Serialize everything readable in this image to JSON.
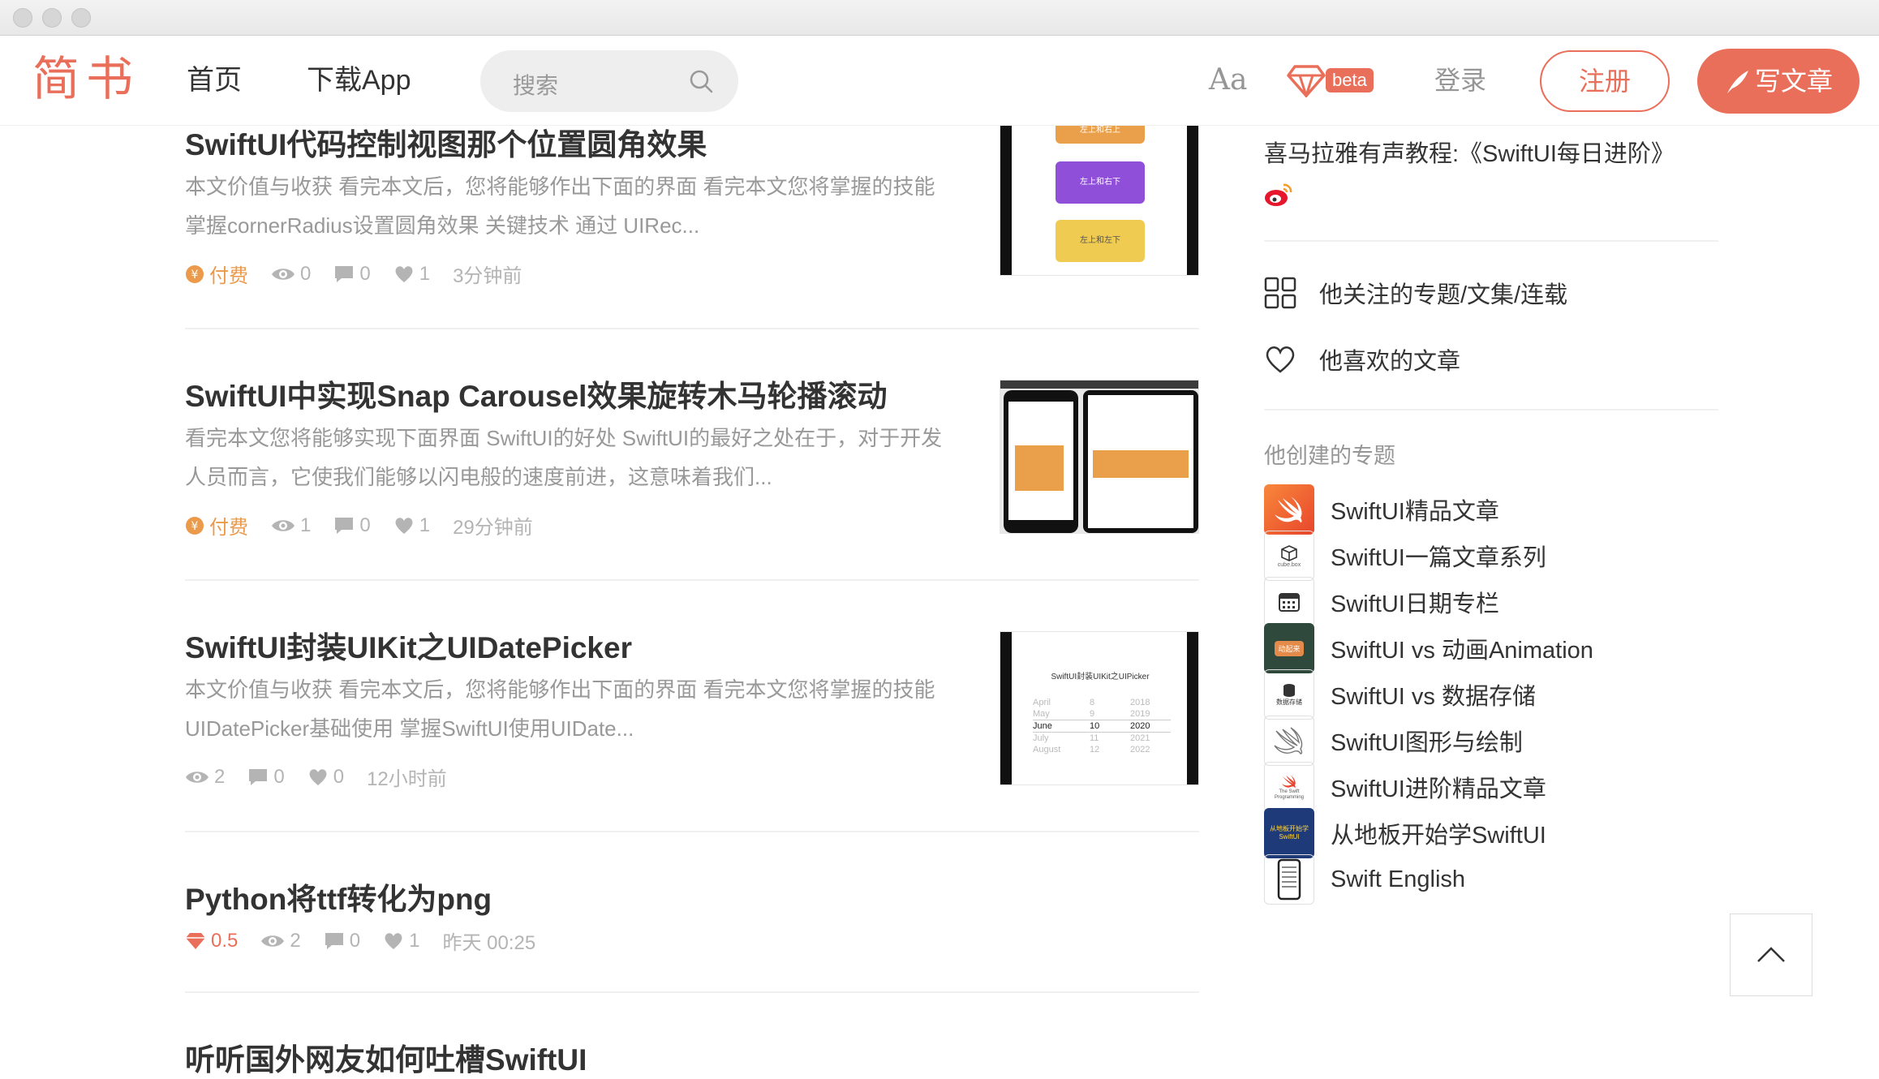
{
  "nav": {
    "logo": "简书",
    "home": "首页",
    "download": "下载App",
    "search_placeholder": "搜索",
    "font_toggle": "Aa",
    "beta": "beta",
    "login": "登录",
    "register": "注册",
    "write": "写文章"
  },
  "articles": [
    {
      "title": "SwiftUI代码控制视图那个位置圆角效果",
      "abstract_1": "本文价值与收获 看完本文后，您将能够作出下面的界面 看完本文您将掌握的技能",
      "abstract_2": "掌握cornerRadius设置圆角效果 关键技术 通过 UIRec...",
      "paid": "付费",
      "views": "0",
      "comments": "0",
      "likes": "1",
      "time": "3分钟前",
      "thumb_labels": [
        "左上和右上",
        "左上和右下",
        "左上和左下"
      ]
    },
    {
      "title": "SwiftUI中实现Snap Carousel效果旋转木马轮播滚动",
      "abstract_1": "看完本文您将能够实现下面界面 SwiftUI的好处 SwiftUI的最好之处在于，对于开发",
      "abstract_2": "人员而言，它使我们能够以闪电般的速度前进，这意味着我们...",
      "paid": "付费",
      "views": "1",
      "comments": "0",
      "likes": "1",
      "time": "29分钟前"
    },
    {
      "title": "SwiftUI封装UIKit之UIDatePicker",
      "abstract_1": "本文价值与收获 看完本文后，您将能够作出下面的界面 看完本文您将掌握的技能",
      "abstract_2": "UIDatePicker基础使用 掌握SwiftUI使用UIDate...",
      "views": "2",
      "comments": "0",
      "likes": "0",
      "time": "12小时前",
      "thumb_title": "SwiftUI封装UIKit之UIPicker",
      "picker_rows": [
        {
          "m": "April",
          "d": "8",
          "y": "2018"
        },
        {
          "m": "May",
          "d": "9",
          "y": "2019"
        },
        {
          "m": "June",
          "d": "10",
          "y": "2020"
        },
        {
          "m": "July",
          "d": "11",
          "y": "2021"
        },
        {
          "m": "August",
          "d": "12",
          "y": "2022"
        }
      ]
    },
    {
      "title": "Python将ttf转化为png",
      "price": "0.5",
      "views": "2",
      "comments": "0",
      "likes": "1",
      "time": "昨天 00:25"
    },
    {
      "title": "听听国外网友如何吐槽SwiftUI"
    }
  ],
  "sidebar": {
    "intro": "喜马拉雅有声教程:《SwiftUI每日进阶》",
    "link_following": "他关注的专题/文集/连载",
    "link_liked": "他喜欢的文章",
    "collections_heading": "他创建的专题",
    "collections": [
      {
        "name": "SwiftUI精品文章",
        "icon": "swift-logo-icon"
      },
      {
        "name": "SwiftUI一篇文章系列",
        "icon": "cube-box-icon",
        "icon_caption": "cube.box"
      },
      {
        "name": "SwiftUI日期专栏",
        "icon": "calendar-icon"
      },
      {
        "name": "SwiftUI vs 动画Animation",
        "icon": "animation-thumb-icon",
        "icon_caption": "动起来"
      },
      {
        "name": "SwiftUI vs 数据存储",
        "icon": "database-icon",
        "icon_caption": "数据存储"
      },
      {
        "name": "SwiftUI图形与绘制",
        "icon": "swift-outline-icon"
      },
      {
        "name": "SwiftUI进阶精品文章",
        "icon": "swift-book-icon",
        "icon_caption": "The Swift Programming"
      },
      {
        "name": "从地板开始学SwiftUI",
        "icon": "book-cover-icon",
        "icon_caption": "从地板开始学 SwiftUI"
      },
      {
        "name": "Swift English",
        "icon": "phone-list-icon"
      }
    ]
  },
  "colors": {
    "brand": "#ea6f5a",
    "paid": "#ea9a4a",
    "meta": "#b4b4b4",
    "thumb_orange": "#eaa04a",
    "thumb_purple": "#8f4fd8",
    "thumb_yellow": "#efcb52"
  }
}
